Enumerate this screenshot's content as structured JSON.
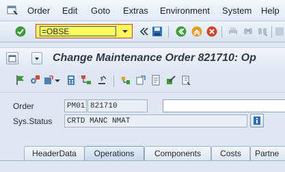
{
  "menu": {
    "items": [
      "Order",
      "Edit",
      "Goto",
      "Extras",
      "Environment",
      "System",
      "Help"
    ]
  },
  "toolbar": {
    "command_value": "=OBSE"
  },
  "title": {
    "text": "Change Maintenance Order 821710: Op"
  },
  "form": {
    "order_label": "Order",
    "order_type": "PM01",
    "order_number": "821710",
    "order_description": "",
    "status_label": "Sys.Status",
    "status_value": "CRTD MANC NMAT"
  },
  "tabs": [
    {
      "label": "HeaderData",
      "active": false
    },
    {
      "label": "Operations",
      "active": true
    },
    {
      "label": "Components",
      "active": false
    },
    {
      "label": "Costs",
      "active": false
    },
    {
      "label": "Partne",
      "active": false
    }
  ],
  "colors": {
    "command_highlight": "#fffb5a",
    "command_border": "#d53a3a",
    "background": "#dfe8f2"
  }
}
